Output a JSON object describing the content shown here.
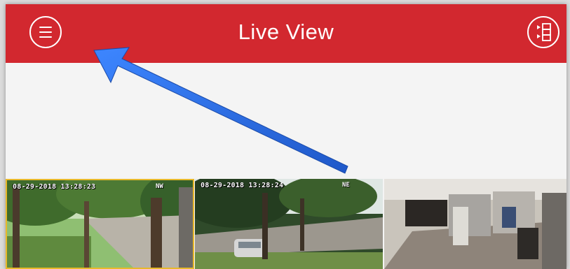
{
  "header": {
    "title": "Live View",
    "menu_icon": "hamburger-menu-icon",
    "layout_icon": "playback-list-icon",
    "background_color": "#d2282f"
  },
  "cameras": [
    {
      "timestamp": "08-29-2018 13:28:23",
      "name": "NW",
      "selected": true
    },
    {
      "timestamp": "08-29-2018 13:28:24",
      "name": "NE",
      "selected": false
    },
    {
      "timestamp": "",
      "name": "",
      "selected": false
    }
  ],
  "annotation": {
    "arrow_color": "#2b6fe0",
    "points_to": "menu-button"
  }
}
